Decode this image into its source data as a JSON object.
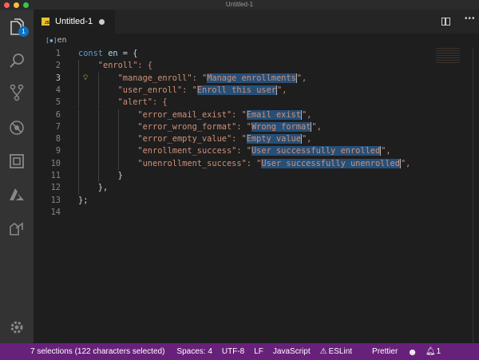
{
  "window": {
    "title": "Untitled-1"
  },
  "activity": {
    "badge": "1",
    "items": [
      "files-icon",
      "search-icon",
      "source-control-icon",
      "debug-icon",
      "extensions-icon",
      "azure-icon",
      "live-share-icon"
    ],
    "settings": "gear-icon"
  },
  "tab": {
    "label": "Untitled-1",
    "file_icon": "JS"
  },
  "breadcrumb": {
    "label": "en"
  },
  "lines": [
    {
      "n": "1"
    },
    {
      "n": "2"
    },
    {
      "n": "3"
    },
    {
      "n": "4"
    },
    {
      "n": "5"
    },
    {
      "n": "6"
    },
    {
      "n": "7"
    },
    {
      "n": "8"
    },
    {
      "n": "9"
    },
    {
      "n": "10"
    },
    {
      "n": "11"
    },
    {
      "n": "12"
    },
    {
      "n": "13"
    },
    {
      "n": "14"
    }
  ],
  "code": {
    "l1a": "const",
    "l1b": "en",
    "l1c": " = {",
    "l2": "\"enroll\": {",
    "l3k": "\"manage_enroll\": \"",
    "l3v": "Manage enrollments",
    "l3e": "\",",
    "l4k": "\"user_enroll\": \"",
    "l4v": "Enroll this user",
    "l4e": "\",",
    "l5": "\"alert\": {",
    "l6k": "\"error_email_exist\": \"",
    "l6v": "Email exist",
    "l6e": "\",",
    "l7k": "\"error_wrong_format\": \"",
    "l7v": "Wrong format",
    "l7e": "\",",
    "l8k": "\"error_empty_value\": \"",
    "l8v": "Empty value",
    "l8e": "\",",
    "l9k": "\"enrollment_success\": \"",
    "l9v": "User successfully enrolled",
    "l9e": "\",",
    "l10k": "\"unenrollment_success\": \"",
    "l10v": "User successfully unenrolled",
    "l10e": "\",",
    "l11": "}",
    "l12": "},",
    "l13": "};"
  },
  "status": {
    "selections": "7 selections (122 characters selected)",
    "spaces": "Spaces: 4",
    "encoding": "UTF-8",
    "eol": "LF",
    "language": "JavaScript",
    "eslint": "ESLint",
    "prettier": "Prettier",
    "notifications": "1"
  },
  "colors": {
    "statusbar": "#68217a",
    "selection": "#264f78",
    "string": "#ce9178",
    "keyword": "#569cd6"
  }
}
